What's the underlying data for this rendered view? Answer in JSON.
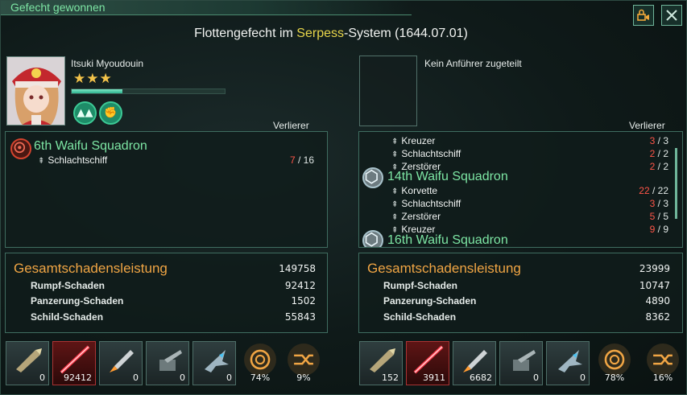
{
  "window": {
    "title": "Gefecht gewonnen",
    "subtitle_prefix": "Flottengefecht im ",
    "system": "Serpess",
    "subtitle_suffix": "-System (1644.07.01)"
  },
  "left": {
    "leader_name": "Itsuki Myoudouin",
    "stars": "★★★",
    "xp_progress_pct": 33,
    "result": "Verlierer",
    "fleets": [
      {
        "name": "6th Waifu Squadron",
        "ships": [
          {
            "type": "Schlachtschiff",
            "lost": "7",
            "total": "16"
          }
        ]
      }
    ],
    "damage": {
      "title": "Gesamtschadensleistung",
      "total": "149758",
      "rows": [
        {
          "label": "Rumpf-Schaden",
          "value": "92412"
        },
        {
          "label": "Panzerung-Schaden",
          "value": "1502"
        },
        {
          "label": "Schild-Schaden",
          "value": "55843"
        }
      ]
    },
    "weapons": [
      "0",
      "92412",
      "0",
      "0",
      "0"
    ],
    "pct": [
      "74%",
      "9%"
    ]
  },
  "right": {
    "no_leader": "Kein Anführer zugeteilt",
    "result": "Verlierer",
    "top_ships": [
      {
        "type": "Kreuzer",
        "lost": "3",
        "total": "3"
      },
      {
        "type": "Schlachtschiff",
        "lost": "2",
        "total": "2"
      },
      {
        "type": "Zerstörer",
        "lost": "2",
        "total": "2"
      }
    ],
    "fleet2": {
      "name": "14th Waifu Squadron",
      "ships": [
        {
          "type": "Korvette",
          "lost": "22",
          "total": "22"
        },
        {
          "type": "Schlachtschiff",
          "lost": "3",
          "total": "3"
        },
        {
          "type": "Zerstörer",
          "lost": "5",
          "total": "5"
        },
        {
          "type": "Kreuzer",
          "lost": "9",
          "total": "9"
        }
      ]
    },
    "fleet3_name": "16th Waifu Squadron",
    "damage": {
      "title": "Gesamtschadensleistung",
      "total": "23999",
      "rows": [
        {
          "label": "Rumpf-Schaden",
          "value": "10747"
        },
        {
          "label": "Panzerung-Schaden",
          "value": "4890"
        },
        {
          "label": "Schild-Schaden",
          "value": "8362"
        }
      ]
    },
    "weapons": [
      "152",
      "3911",
      "6682",
      "0",
      "0"
    ],
    "pct": [
      "78%",
      "16%"
    ]
  },
  "colors": {
    "accent": "#7de6a4",
    "loss": "#ff5548",
    "damage_title": "#f0a544",
    "system": "#e8d64a"
  }
}
